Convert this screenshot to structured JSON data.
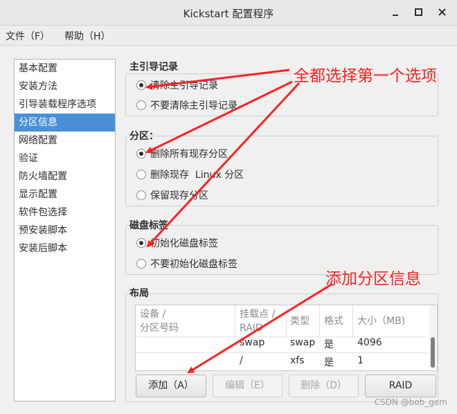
{
  "window": {
    "title": "Kickstart 配置程序",
    "minimize_icon": "minimize-icon",
    "maximize_icon": "maximize-icon",
    "close_icon": "close-icon"
  },
  "menu": {
    "file": "文件（F）",
    "help": "帮助（H）"
  },
  "sidebar": {
    "selected_index": 3,
    "selection_color": "#4a90d9",
    "items": [
      {
        "label": "基本配置"
      },
      {
        "label": "安装方法"
      },
      {
        "label": "引导装载程序选项"
      },
      {
        "label": "分区信息"
      },
      {
        "label": "网络配置"
      },
      {
        "label": "验证"
      },
      {
        "label": "防火墙配置"
      },
      {
        "label": "显示配置"
      },
      {
        "label": "软件包选择"
      },
      {
        "label": "预安装脚本"
      },
      {
        "label": "安装后脚本"
      }
    ]
  },
  "mbr": {
    "title": "主引导记录",
    "options": [
      {
        "label": "清除主引导记录",
        "checked": true
      },
      {
        "label": "不要清除主引导记录",
        "checked": false
      }
    ]
  },
  "partitions": {
    "title": "分区：",
    "options": [
      {
        "label": "删除所有现存分区",
        "checked": true
      },
      {
        "label": "删除现存  Linux 分区",
        "checked": false
      },
      {
        "label": "保留现存分区",
        "checked": false
      }
    ]
  },
  "disk_label": {
    "title": "磁盘标签",
    "options": [
      {
        "label": "初始化磁盘标签",
        "checked": true
      },
      {
        "label": "不要初始化磁盘标签",
        "checked": false
      }
    ]
  },
  "layout": {
    "title": "布局",
    "columns": {
      "device_line1": "设备 /",
      "device_line2": "分区号码",
      "mount_line1": "挂载点 /",
      "mount_line2": "RAID",
      "type": "类型",
      "format": "格式",
      "size": "大小（MB)"
    },
    "rows": [
      {
        "device": "",
        "mount": "swap",
        "type": "swap",
        "format": "是",
        "size": "4096"
      },
      {
        "device": "",
        "mount": "/",
        "type": "xfs",
        "format": "是",
        "size": "1"
      }
    ],
    "buttons": {
      "add": "添加（A）",
      "edit": "编辑（E）",
      "delete": "删除（D）",
      "raid": "RAID"
    }
  },
  "annotations": {
    "select_first": "全都选择第一个选项",
    "add_partition": "添加分区信息",
    "color": "#ff2020"
  },
  "watermark": "CSDN @bob_gem"
}
